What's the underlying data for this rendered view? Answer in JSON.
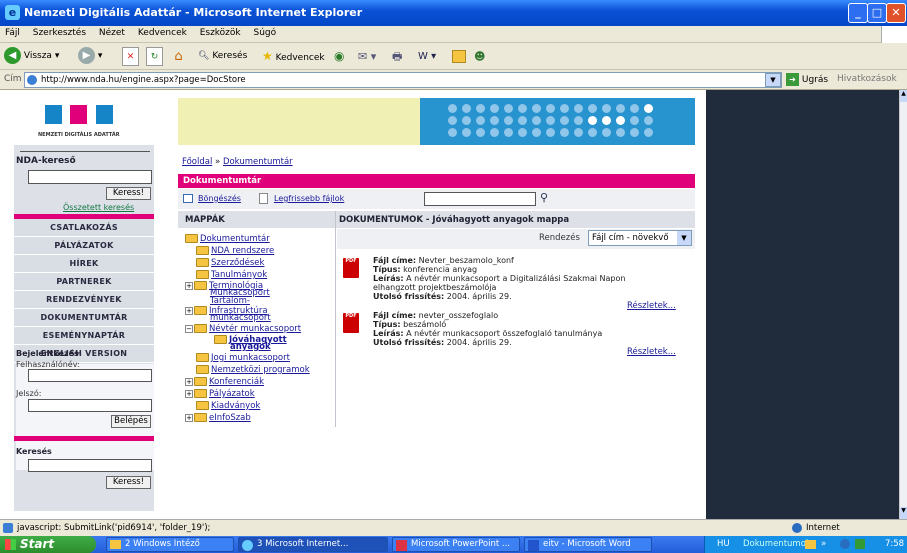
{
  "window": {
    "title": "Nemzeti Digitális Adattár - Microsoft Internet Explorer"
  },
  "menu": [
    "Fájl",
    "Szerkesztés",
    "Nézet",
    "Kedvencek",
    "Eszközök",
    "Súgó"
  ],
  "toolbar": {
    "back": "Vissza",
    "search": "Keresés",
    "favorites": "Kedvencek"
  },
  "address": {
    "label": "Cím",
    "url": "http://www.nda.hu/engine.aspx?page=DocStore",
    "go": "Ugrás",
    "links": "Hivatkozások"
  },
  "logo": {
    "text": "NEMZETI DIGITÁLIS ADATTÁR"
  },
  "sidebar": {
    "search_title": "NDA-kereső",
    "search_button": "Keress!",
    "advanced_search": "Összetett keresés",
    "nav": [
      "CSATLAKOZÁS",
      "PÁLYÁZATOK",
      "HÍREK",
      "PARTNEREK",
      "RENDEZVÉNYEK",
      "DOKUMENTUMTÁR",
      "ESEMÉNYNAPTÁR",
      "ENGLISH VERSION"
    ],
    "login_title": "Bejelentkezés",
    "username_label": "Felhasználónév:",
    "password_label": "Jelszó:",
    "login_button": "Belépés",
    "search2_title": "Keresés",
    "search2_button": "Keress!"
  },
  "breadcrumb": {
    "home": "Főoldal",
    "sep": "»",
    "current": "Dokumentumtár"
  },
  "section_title": "Dokumentumtár",
  "subbar": {
    "browse": "Böngészés",
    "latest": "Legfrissebb fájlok"
  },
  "folders_header": "MAPPÁK",
  "docs_header": "DOKUMENTUMOK - Jóváhagyott anyagok mappa",
  "sort": {
    "label": "Rendezés",
    "value": "Fájl cím - növekvő"
  },
  "tree": [
    {
      "label": "Dokumentumtár"
    },
    {
      "label": "NDA rendszere"
    },
    {
      "label": "Szerződések"
    },
    {
      "label": "Tanulmányok"
    },
    {
      "label": "Terminológia"
    },
    {
      "label": "Munkacsoport"
    },
    {
      "label": "Tartalom-"
    },
    {
      "label": "Infrastruktúra"
    },
    {
      "label": "munkacsoport"
    },
    {
      "label": "Névtér munkacsoport"
    },
    {
      "label": "Jóváhagyott"
    },
    {
      "label": "anyagok"
    },
    {
      "label": "Jogi munkacsoport"
    },
    {
      "label": "Nemzetközi programok"
    },
    {
      "label": "Konferenciák"
    },
    {
      "label": "Pályázatok"
    },
    {
      "label": "Kiadványok"
    },
    {
      "label": "eInfoSzab"
    }
  ],
  "documents": [
    {
      "title_label": "Fájl címe:",
      "title": "Nevter_beszamolo_konf",
      "type_label": "Típus:",
      "type": "konferencia anyag",
      "desc_label": "Leírás:",
      "desc": "A névtér munkacsoport a Digitalizálási Szakmai Napon",
      "desc2": "elhangzott projektbeszámolója",
      "updated_label": "Utolsó frissítés:",
      "updated": "2004. április 29.",
      "details": "Részletek..."
    },
    {
      "title_label": "Fájl címe:",
      "title": "nevter_osszefoglalo",
      "type_label": "Típus:",
      "type": "beszámoló",
      "desc_label": "Leírás:",
      "desc": "A névtér munkacsoport összefoglaló tanulmánya",
      "updated_label": "Utolsó frissítés:",
      "updated": "2004. április 29.",
      "details": "Részletek..."
    }
  ],
  "status": {
    "text": "javascript: SubmitLink('pid6914', 'folder_19');",
    "zone": "Internet"
  },
  "taskbar": {
    "start": "Start",
    "tasks": [
      "2 Windows Intéző",
      "3 Microsoft Internet...",
      "Microsoft PowerPoint ...",
      "eitv - Microsoft Word"
    ],
    "lang": "HU",
    "tray_label": "Dokumentumok",
    "time": "7:58"
  },
  "colors": {
    "magenta": "#e0007a",
    "blue": "#1585c8",
    "header_bg": "#d9dde4"
  }
}
